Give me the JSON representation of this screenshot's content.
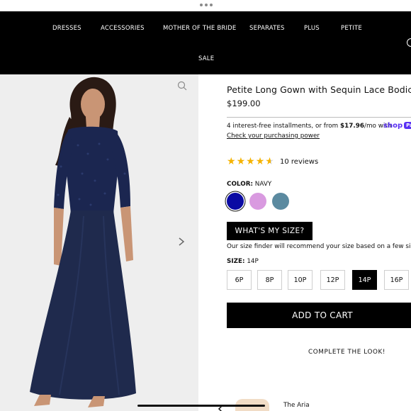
{
  "nav": {
    "items": [
      {
        "label": "DRESSES"
      },
      {
        "label": "ACCESSORIES"
      },
      {
        "label": "MOTHER OF THE BRIDE"
      },
      {
        "label": "SEPARATES"
      },
      {
        "label": "PLUS"
      },
      {
        "label": "PETITE"
      },
      {
        "label": "SALE"
      }
    ],
    "search_icon": "search-icon"
  },
  "gallery": {
    "zoom_icon": "zoom-icon",
    "next_icon": "chevron-right-icon",
    "dress_color": "#1f2a4d"
  },
  "product": {
    "title": "Petite Long Gown with Sequin Lace Bodice &",
    "price": "$199.00",
    "installments_prefix": "4 interest-free installments, or from ",
    "installments_amount": "$17.96",
    "installments_suffix": "/mo with",
    "shop_logo": "shop",
    "shop_pay_chip": "Pay",
    "check_link": "Check your purchasing power",
    "rating": 4.5,
    "reviews": "10 reviews",
    "color_label": "COLOR:",
    "color_value": "NAVY",
    "swatches": [
      {
        "name": "Navy",
        "color": "#0a0aa3",
        "selected": true
      },
      {
        "name": "Pink",
        "color": "#d99ae0",
        "selected": false
      },
      {
        "name": "Teal",
        "color": "#5b8aa0",
        "selected": false
      }
    ],
    "whats_my_size": "WHAT'S MY SIZE?",
    "size_finder_text": "Our size finder will recommend your size based on a few simp",
    "size_label": "SIZE:",
    "size_value": "14P",
    "sizes": [
      "6P",
      "8P",
      "10P",
      "12P",
      "14P",
      "16P"
    ],
    "selected_size": "14P",
    "add_to_cart": "ADD TO CART",
    "complete_look": "COMPLETE THE LOOK!",
    "related_item": "The Aria"
  },
  "colors": {
    "nav_bg": "#000000",
    "star": "#f5b301",
    "shop_purple": "#5a31f4"
  }
}
